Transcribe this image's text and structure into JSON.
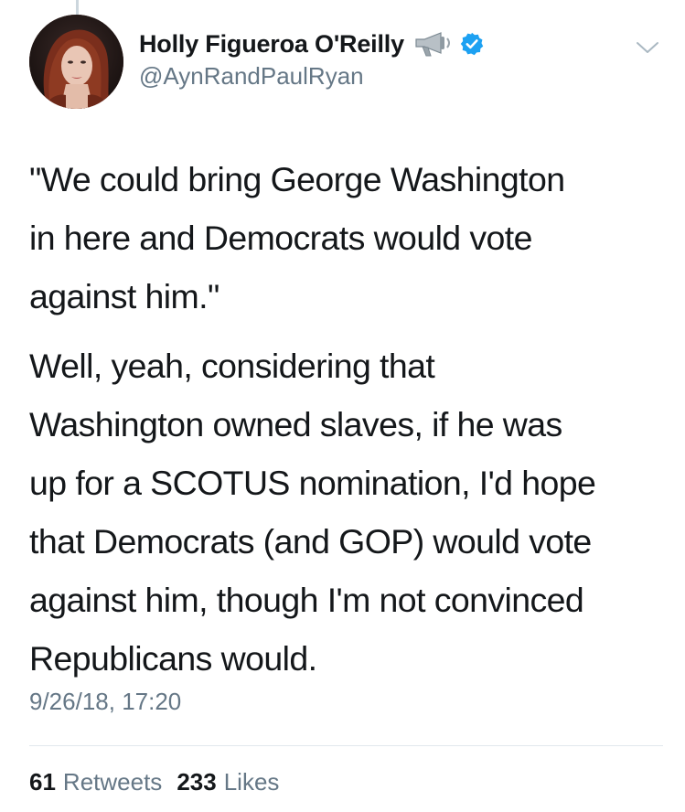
{
  "tweet": {
    "author": {
      "display_name": "Holly Figueroa O'Reilly",
      "handle": "@AynRandPaulRyan",
      "avatar_icon": "profile-photo",
      "badges": [
        "megaphone-icon",
        "verified-badge-icon"
      ]
    },
    "menu_icon": "chevron-down-icon",
    "paragraphs": [
      "\"We could bring George Washington\nin here and Democrats would vote\nagainst him.\"",
      "Well, yeah, considering that\nWashington owned slaves, if he was\nup for a SCOTUS nomination, I'd hope\nthat Democrats (and GOP) would vote\nagainst him, though I'm not convinced\nRepublicans would."
    ],
    "timestamp": "9/26/18, 17:20",
    "stats": {
      "retweets_count": "61",
      "retweets_label": "Retweets",
      "likes_count": "233",
      "likes_label": "Likes"
    }
  },
  "colors": {
    "text_primary": "#14171a",
    "text_secondary": "#657786",
    "verified_blue": "#1da1f2",
    "divider": "#e1e8ed"
  }
}
